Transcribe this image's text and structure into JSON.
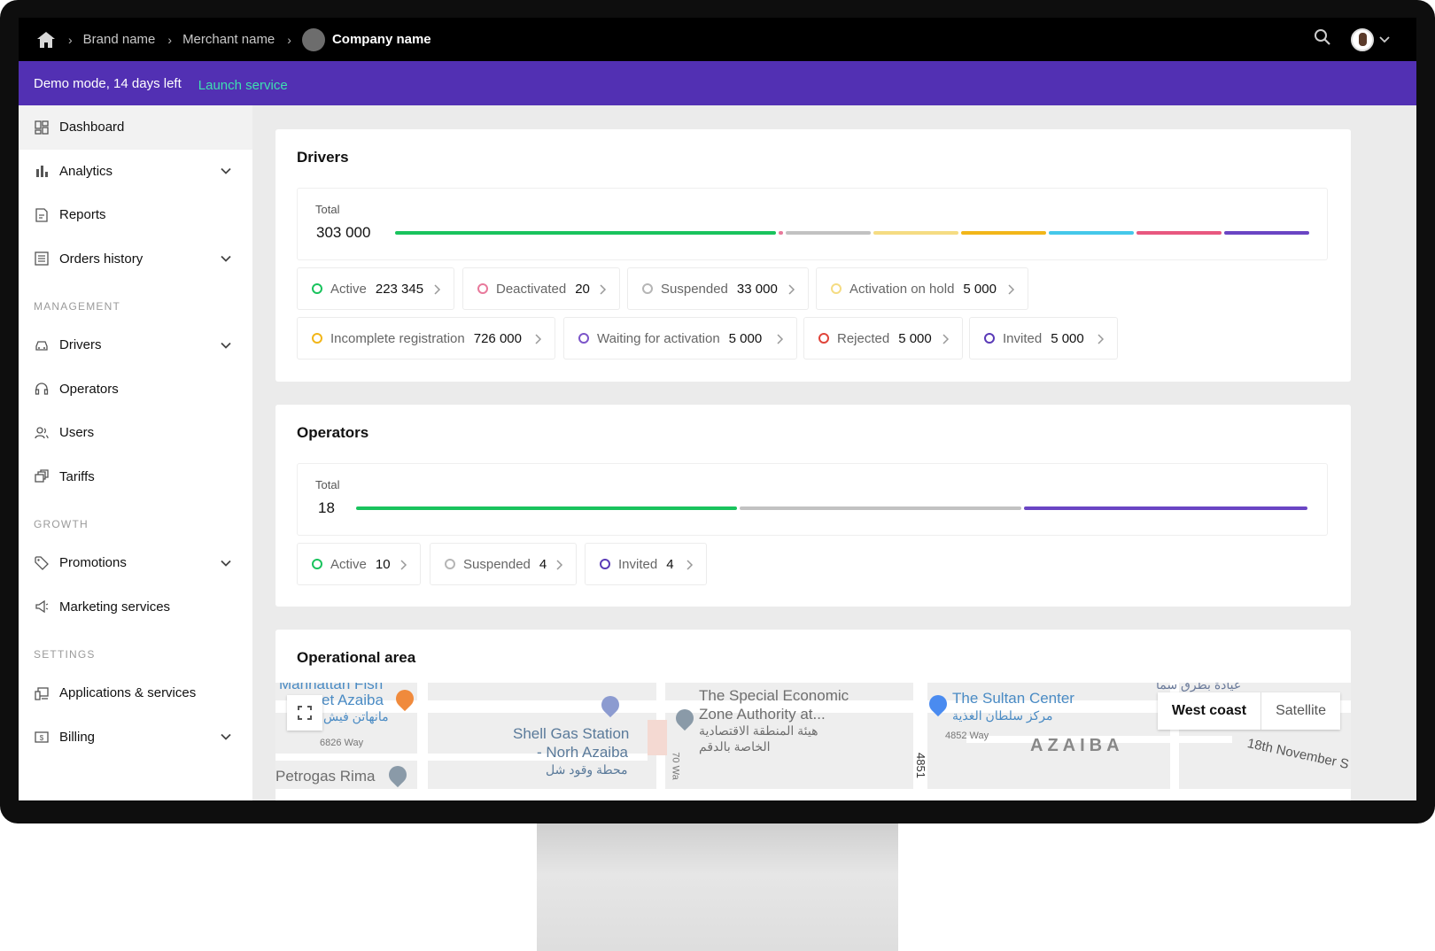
{
  "breadcrumb": {
    "items": [
      "Brand name",
      "Merchant name"
    ],
    "current": "Company name"
  },
  "demo": {
    "text": "Demo mode, 14 days left",
    "action": "Launch service"
  },
  "sidebar": {
    "dashboard": "Dashboard",
    "analytics": "Analytics",
    "reports": "Reports",
    "orders_history": "Orders history",
    "section_management": "MANAGEMENT",
    "drivers": "Drivers",
    "operators": "Operators",
    "users": "Users",
    "tariffs": "Tariffs",
    "section_growth": "GROWTH",
    "promotions": "Promotions",
    "marketing": "Marketing services",
    "section_settings": "SETTINGS",
    "apps": "Applications & services",
    "billing": "Billing"
  },
  "drivers": {
    "title": "Drivers",
    "total_label": "Total",
    "total_value": "303 000",
    "statuses": [
      {
        "label": "Active",
        "count": "223 345",
        "color": "#19c35d"
      },
      {
        "label": "Deactivated",
        "count": "20",
        "color": "#e8799b"
      },
      {
        "label": "Suspended",
        "count": "33 000",
        "color": "#b5b5b5"
      },
      {
        "label": "Activation on hold",
        "count": "5 000",
        "color": "#f5dc82"
      },
      {
        "label": "Incomplete registration",
        "count": "726 000",
        "color": "#f2b619"
      },
      {
        "label": "Waiting for activation",
        "count": "5 000",
        "color": "#7c55c9"
      },
      {
        "label": "Rejected",
        "count": "5 000",
        "color": "#e0443a"
      },
      {
        "label": "Invited",
        "count": "5 000",
        "color": "#5a3ab7"
      }
    ],
    "bar_colors": [
      "#19c35d",
      "#e8799b",
      "#c2c2c2",
      "#f5dc82",
      "#f2b619",
      "#45c8ea",
      "#e8587f",
      "#6a45c4"
    ]
  },
  "operators": {
    "title": "Operators",
    "total_label": "Total",
    "total_value": "18",
    "statuses": [
      {
        "label": "Active",
        "count": "10",
        "color": "#19c35d"
      },
      {
        "label": "Suspended",
        "count": "4",
        "color": "#b5b5b5"
      },
      {
        "label": "Invited",
        "count": "4",
        "color": "#5a3ab7"
      }
    ]
  },
  "operational_area": {
    "title": "Operational area",
    "map_type_active": "West coast",
    "map_type_other": "Satellite",
    "places": {
      "manhattan_en": "Manhattan Fish",
      "market_en": "et Azaiba",
      "market_ar": "مانهاتن فيش",
      "way_6826": "6826 Way",
      "petrogas": "Petrogas Rima",
      "shell_line1": "Shell Gas Station",
      "shell_line2": "- Norh Azaiba",
      "shell_ar": "محطة وقود شل",
      "sez_line1": "The Special Economic",
      "sez_line2": "Zone Authority at...",
      "sez_ar1": "هيئة المنطقة الاقتصادية",
      "sez_ar2": "الخاصة بالدقم",
      "sultan_en": "The Sultan Center",
      "sultan_ar": "مركز سلطان الغذية",
      "way_4852": "4852 Way",
      "azaiba": "AZAIBA",
      "nov18": "18th November S",
      "way_4851": "4851",
      "way_70": "70 Wa",
      "clinic_ar": "عيادة بطرق سما"
    }
  }
}
